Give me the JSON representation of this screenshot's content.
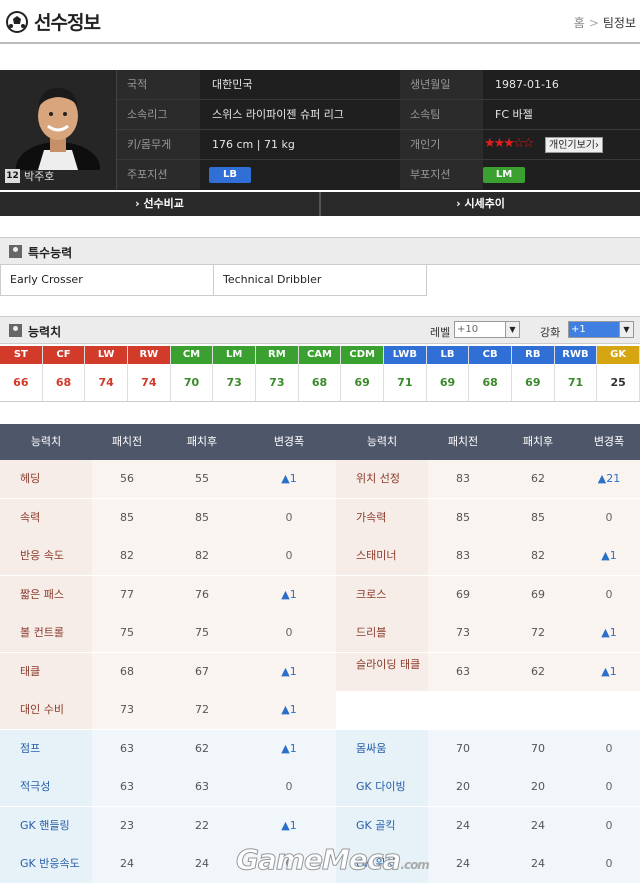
{
  "header": {
    "title": "선수정보",
    "breadcrumb": [
      "홈",
      "팀정보"
    ]
  },
  "player": {
    "number": "12",
    "name": "박주호",
    "fields": {
      "nationality_label": "국적",
      "nationality": "대한민국",
      "birth_label": "생년월일",
      "birth": "1987-01-16",
      "league_label": "소속리그",
      "league": "스위스 라이파이젠 슈퍼 리그",
      "team_label": "소속팀",
      "team": "FC 바젤",
      "body_label": "키/몸무게",
      "body": "176 cm | 71 kg",
      "skill_label": "개인기",
      "skill_stars": "★★★☆☆",
      "skill_button": "개인기보기",
      "main_pos_label": "주포지션",
      "main_pos": "LB",
      "sub_pos_label": "부포지션",
      "sub_pos": "LM"
    },
    "colors": {
      "main_pos": "#2f6fd6",
      "sub_pos": "#3aa02f"
    }
  },
  "nav": {
    "compare": "› 선수비교",
    "price": "› 시세추이"
  },
  "special": {
    "title": "특수능력",
    "traits": [
      "Early Crosser",
      "Technical Dribbler"
    ]
  },
  "ability": {
    "title": "능력치",
    "level_label": "레벨",
    "level_value": "+10",
    "enhance_label": "강화",
    "enhance_value": "+1"
  },
  "overall": [
    {
      "pos": "ST",
      "value": "66",
      "color": "#d23a2a"
    },
    {
      "pos": "CF",
      "value": "68",
      "color": "#d23a2a"
    },
    {
      "pos": "LW",
      "value": "74",
      "color": "#d23a2a"
    },
    {
      "pos": "RW",
      "value": "74",
      "color": "#d23a2a"
    },
    {
      "pos": "CM",
      "value": "70",
      "color": "#3aa02f"
    },
    {
      "pos": "LM",
      "value": "73",
      "color": "#3aa02f"
    },
    {
      "pos": "RM",
      "value": "73",
      "color": "#3aa02f"
    },
    {
      "pos": "CAM",
      "value": "68",
      "color": "#3aa02f"
    },
    {
      "pos": "CDM",
      "value": "69",
      "color": "#3aa02f"
    },
    {
      "pos": "LWB",
      "value": "71",
      "color": "#2f6fd6"
    },
    {
      "pos": "LB",
      "value": "69",
      "color": "#2f6fd6"
    },
    {
      "pos": "CB",
      "value": "68",
      "color": "#2f6fd6"
    },
    {
      "pos": "RB",
      "value": "69",
      "color": "#2f6fd6"
    },
    {
      "pos": "RWB",
      "value": "71",
      "color": "#2f6fd6"
    },
    {
      "pos": "GK",
      "value": "25",
      "color": "#d6a512"
    }
  ],
  "stats_header": [
    "능력치",
    "패치전",
    "패치후",
    "변경폭",
    "능력치",
    "패치전",
    "패치후",
    "변경폭"
  ],
  "stats_rows": [
    {
      "left": {
        "name": "헤딩",
        "before": "56",
        "after": "55",
        "change": "▲1"
      },
      "right": {
        "name": "위치 선정",
        "before": "83",
        "after": "62",
        "change": "▲21"
      }
    },
    {
      "left": {
        "name": "속력",
        "before": "85",
        "after": "85",
        "change": "0"
      },
      "right": {
        "name": "가속력",
        "before": "85",
        "after": "85",
        "change": "0"
      }
    },
    {
      "left": {
        "name": "반응 속도",
        "before": "82",
        "after": "82",
        "change": "0"
      },
      "right": {
        "name": "스태미너",
        "before": "83",
        "after": "82",
        "change": "▲1"
      }
    },
    {
      "left": {
        "name": "짧은 패스",
        "before": "77",
        "after": "76",
        "change": "▲1"
      },
      "right": {
        "name": "크로스",
        "before": "69",
        "after": "69",
        "change": "0"
      }
    },
    {
      "left": {
        "name": "볼 컨트롤",
        "before": "75",
        "after": "75",
        "change": "0"
      },
      "right": {
        "name": "드리블",
        "before": "73",
        "after": "72",
        "change": "▲1"
      }
    },
    {
      "left": {
        "name": "태클",
        "before": "68",
        "after": "67",
        "change": "▲1"
      },
      "right": {
        "name": "슬라이딩 태클",
        "before": "63",
        "after": "62",
        "change": "▲1"
      }
    },
    {
      "left": {
        "name": "대인 수비",
        "before": "73",
        "after": "72",
        "change": "▲1"
      },
      "right": null
    },
    {
      "left": {
        "name": "점프",
        "before": "63",
        "after": "62",
        "change": "▲1"
      },
      "right": {
        "name": "몸싸움",
        "before": "70",
        "after": "70",
        "change": "0"
      }
    },
    {
      "left": {
        "name": "적극성",
        "before": "63",
        "after": "63",
        "change": "0"
      },
      "right": {
        "name": "GK 다이빙",
        "before": "20",
        "after": "20",
        "change": "0"
      }
    },
    {
      "left": {
        "name": "GK 핸들링",
        "before": "23",
        "after": "22",
        "change": "▲1"
      },
      "right": {
        "name": "GK 골킥",
        "before": "24",
        "after": "24",
        "change": "0"
      }
    },
    {
      "left": {
        "name": "GK 반응속도",
        "before": "24",
        "after": "24",
        "change": "0"
      },
      "right": {
        "name": "GK 위치",
        "before": "24",
        "after": "24",
        "change": "0"
      }
    }
  ],
  "watermark": {
    "brand": "GameMeca",
    "tld": ".com"
  }
}
